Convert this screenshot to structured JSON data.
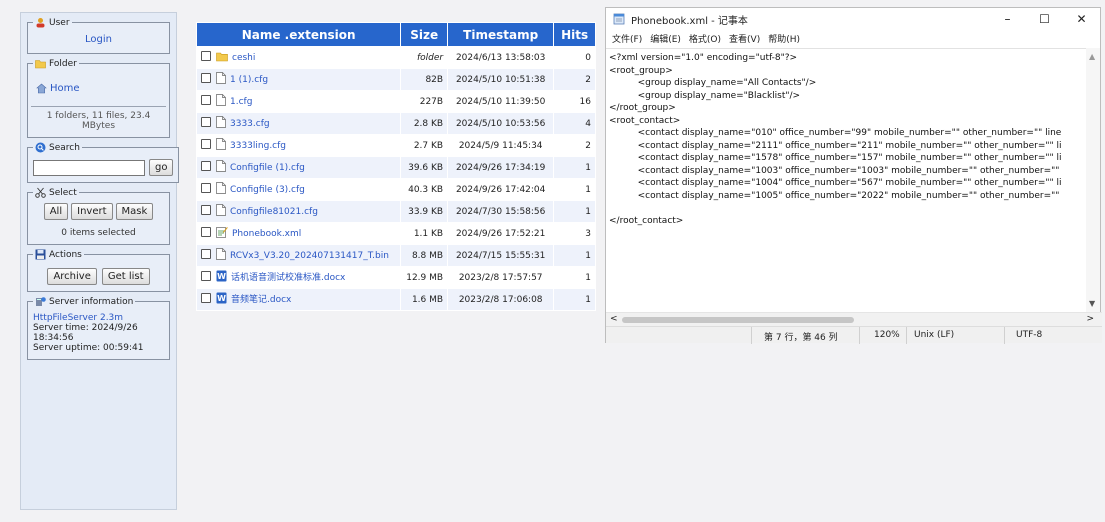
{
  "sidebar": {
    "user": {
      "legend": "User",
      "login_link": "Login"
    },
    "folder": {
      "legend": "Folder",
      "home_link": "Home",
      "info": "1 folders, 11 files, 23.4 MBytes"
    },
    "search": {
      "legend": "Search",
      "go_label": "go",
      "placeholder": ""
    },
    "select": {
      "legend": "Select",
      "all_label": "All",
      "invert_label": "Invert",
      "mask_label": "Mask",
      "info": "0 items selected"
    },
    "actions": {
      "legend": "Actions",
      "archive_label": "Archive",
      "getlist_label": "Get list"
    },
    "server": {
      "legend": "Server information",
      "link": "HttpFileServer 2.3m",
      "time": "Server time: 2024/9/26 18:34:56",
      "uptime": "Server uptime: 00:59:41"
    }
  },
  "files": {
    "headers": {
      "name": "Name .extension",
      "size": "Size",
      "timestamp": "Timestamp",
      "hits": "Hits"
    },
    "rows": [
      {
        "name": "ceshi",
        "size": "folder",
        "time": "2024/6/13 13:58:03",
        "hits": "0",
        "icon": "folder-icon"
      },
      {
        "name": "1 (1).cfg",
        "size": "82B",
        "time": "2024/5/10 10:51:38",
        "hits": "2",
        "icon": "file-icon"
      },
      {
        "name": "1.cfg",
        "size": "227B",
        "time": "2024/5/10 11:39:50",
        "hits": "16",
        "icon": "file-icon"
      },
      {
        "name": "3333.cfg",
        "size": "2.8 KB",
        "time": "2024/5/10 10:53:56",
        "hits": "4",
        "icon": "file-icon"
      },
      {
        "name": "3333ling.cfg",
        "size": "2.7 KB",
        "time": "2024/5/9 11:45:34",
        "hits": "2",
        "icon": "file-icon"
      },
      {
        "name": "Configfile (1).cfg",
        "size": "39.6 KB",
        "time": "2024/9/26 17:34:19",
        "hits": "1",
        "icon": "file-icon"
      },
      {
        "name": "Configfile (3).cfg",
        "size": "40.3 KB",
        "time": "2024/9/26 17:42:04",
        "hits": "1",
        "icon": "file-icon"
      },
      {
        "name": "Configfile81021.cfg",
        "size": "33.9 KB",
        "time": "2024/7/30 15:58:56",
        "hits": "1",
        "icon": "file-icon"
      },
      {
        "name": "Phonebook.xml",
        "size": "1.1 KB",
        "time": "2024/9/26 17:52:21",
        "hits": "3",
        "icon": "xml-file-icon"
      },
      {
        "name": "RCVx3_V3.20_202407131417_T.bin",
        "size": "8.8 MB",
        "time": "2024/7/15 15:55:31",
        "hits": "1",
        "icon": "file-icon"
      },
      {
        "name": "话机语音测试校准标准.docx",
        "size": "12.9 MB",
        "time": "2023/2/8 17:57:57",
        "hits": "1",
        "icon": "word-doc-icon"
      },
      {
        "name": "音频笔记.docx",
        "size": "1.6 MB",
        "time": "2023/2/8 17:06:08",
        "hits": "1",
        "icon": "word-doc-icon"
      }
    ]
  },
  "notepad": {
    "title": "Phonebook.xml - 记事本",
    "menu": [
      "文件(F)",
      "编辑(E)",
      "格式(O)",
      "查看(V)",
      "帮助(H)"
    ],
    "lines": [
      "<?xml version=\"1.0\" encoding=\"utf-8\"?>",
      "<root_group>",
      "\t<group display_name=\"All Contacts\"/>",
      "\t<group display_name=\"Blacklist\"/>",
      "</root_group>",
      "<root_contact>",
      "\t<contact display_name=\"010\" office_number=\"99\" mobile_number=\"\" other_number=\"\" line",
      "\t<contact display_name=\"2111\" office_number=\"211\" mobile_number=\"\" other_number=\"\" li",
      "\t<contact display_name=\"1578\" office_number=\"157\" mobile_number=\"\" other_number=\"\" li",
      "\t<contact display_name=\"1003\" office_number=\"1003\" mobile_number=\"\" other_number=\"\"",
      "\t<contact display_name=\"1004\" office_number=\"567\" mobile_number=\"\" other_number=\"\" li",
      "\t<contact display_name=\"1005\" office_number=\"2022\" mobile_number=\"\" other_number=\"\"",
      "",
      "</root_contact>"
    ],
    "status": {
      "position": "第 7 行，第 46 列",
      "zoom": "120%",
      "eol": "Unix (LF)",
      "encoding": "UTF-8"
    },
    "controls": {
      "minimize": "–",
      "maximize": "☐",
      "close": "✕"
    }
  }
}
